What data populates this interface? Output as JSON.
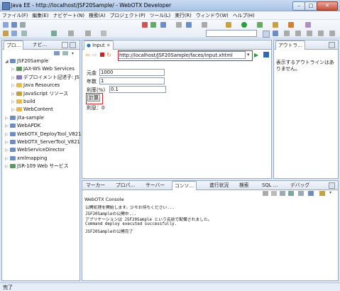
{
  "window": {
    "title": "Java EE - http://localhost/JSF20Sample/ - WebOTX Developer",
    "min": "–",
    "max": "□",
    "close": "✕"
  },
  "menu": [
    "ファイル(F)",
    "編集(E)",
    "ナビゲート(N)",
    "検索(A)",
    "プロジェクト(P)",
    "ツール(L)",
    "実行(R)",
    "ウィンドウ(W)",
    "ヘルプ(H)"
  ],
  "left_panel": {
    "tabs": [
      "プロ…",
      "ナビ…"
    ],
    "tree": [
      {
        "label": "JSF20Sample",
        "expanded": true,
        "depth": 0,
        "icon": "project"
      },
      {
        "label": "JAX-WS Web Services",
        "depth": 1,
        "icon": "ws"
      },
      {
        "label": "デプロイメント記述子: JS",
        "depth": 1,
        "icon": "dd"
      },
      {
        "label": "Java Resources",
        "depth": 1,
        "icon": "folder"
      },
      {
        "label": "JavaScript リソース",
        "depth": 1,
        "icon": "js"
      },
      {
        "label": "build",
        "depth": 1,
        "icon": "folder"
      },
      {
        "label": "WebContent",
        "depth": 1,
        "icon": "folder"
      },
      {
        "label": "jita-sample",
        "depth": 0,
        "icon": "project"
      },
      {
        "label": "WebAPDK",
        "depth": 0,
        "icon": "project"
      },
      {
        "label": "WebOTX_DeployTool_V821",
        "depth": 0,
        "icon": "project"
      },
      {
        "label": "WebOTX_ServerTool_V821",
        "depth": 0,
        "icon": "project"
      },
      {
        "label": "WebServiceDirector",
        "depth": 0,
        "icon": "project"
      },
      {
        "label": "xmlmapping",
        "depth": 0,
        "icon": "project"
      },
      {
        "label": "JSR-109 Web サービス",
        "depth": 0,
        "icon": "ws"
      }
    ]
  },
  "editor": {
    "tab": "Input",
    "url": "http://localhost/JSF20Sample/faces/input.xhtml",
    "form": {
      "principal_label": "元金",
      "principal_value": "1000",
      "years_label": "年数",
      "years_value": "1",
      "rate_label": "利率(%)",
      "rate_value": "0.1",
      "calc_button": "計算",
      "interest_label": "利息：0"
    }
  },
  "outline": {
    "tab": "アウトラ…",
    "message": "表示するアウトラインはありません。"
  },
  "bottom": {
    "tabs": [
      "マーカー",
      "プロパ…",
      "サーバー",
      "コンソ…",
      "進行状況",
      "検索",
      "SQL …",
      "デバッグ"
    ],
    "console_title": "WebOTX Console",
    "lines": [
      "公開処理を開始します。少々お待ちください...",
      "JSF20Sampleの公開中...",
      "アプリケーションは JSF20Sample という名前で配備されました。",
      "Command deploy executed successfully.",
      "JSF20Sampleの公開完了"
    ]
  },
  "status": "完了",
  "colors": {
    "highlight": "#d42020",
    "folder": "#e8b84a",
    "project": "#6b8fc4"
  }
}
